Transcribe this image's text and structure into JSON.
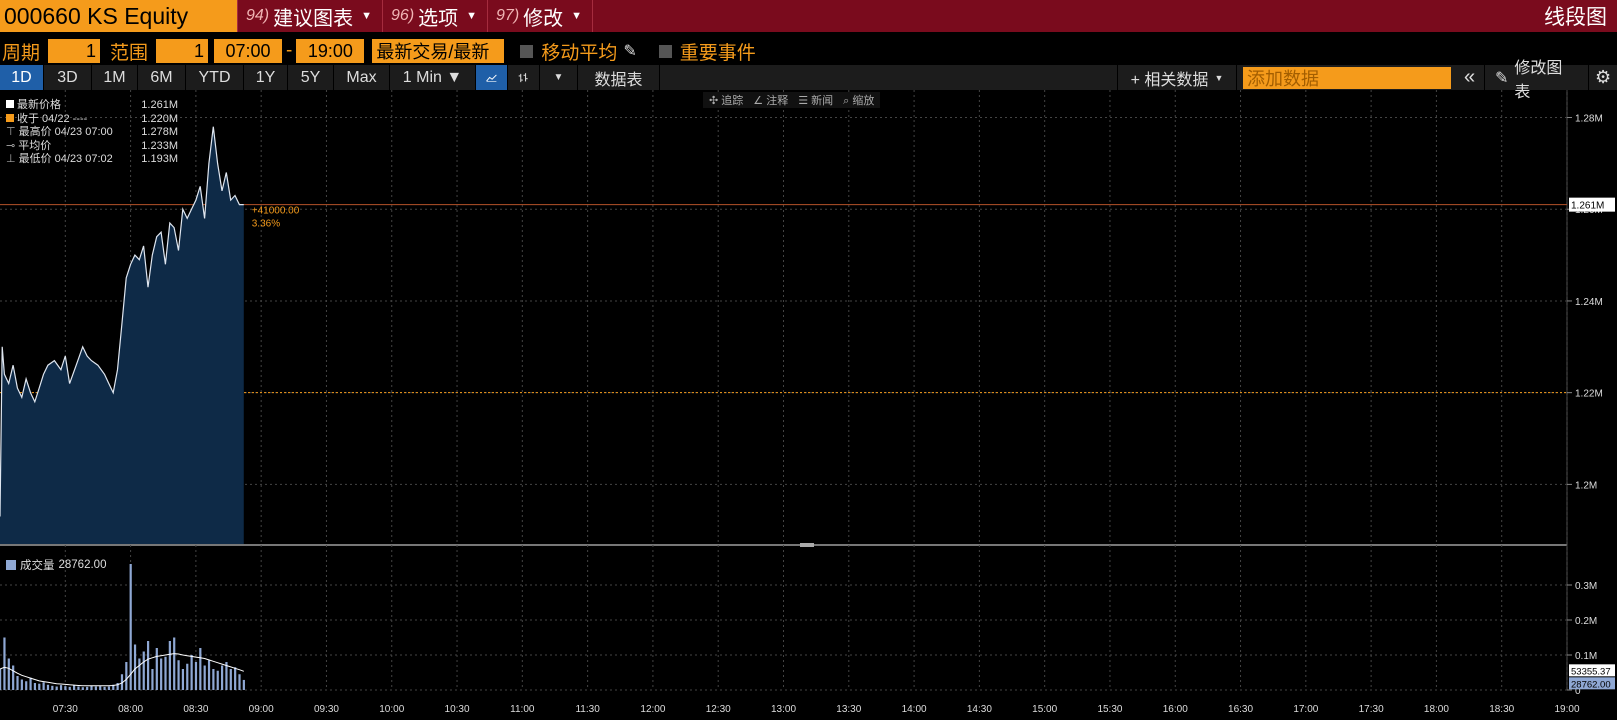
{
  "header": {
    "ticker": "000660 KS Equity",
    "menus": [
      {
        "num": "94)",
        "label": "建议图表"
      },
      {
        "num": "96)",
        "label": "选项"
      },
      {
        "num": "97)",
        "label": "修改"
      }
    ],
    "right_title": "线段图"
  },
  "controls": {
    "period_label": "周期",
    "period_value": "1",
    "range_label": "范围",
    "range_value": "1",
    "time_start": "07:00",
    "time_sep": "-",
    "time_end": "19:00",
    "price_type": "最新交易/最新",
    "moving_avg": "移动平均",
    "events": "重要事件"
  },
  "toolbar": {
    "ranges": [
      "1D",
      "3D",
      "1M",
      "6M",
      "YTD",
      "1Y",
      "5Y",
      "Max"
    ],
    "active_range": "1D",
    "interval": "1 Min ▼",
    "data_table": "数据表",
    "related_data": "+ 相关数据",
    "add_data_placeholder": "添加数据",
    "collapse": "«",
    "edit_chart": "修改图表",
    "gear": "⚙"
  },
  "chart_tools": [
    "✣ 追踪",
    "∠ 注释",
    "☰ 新闻",
    "⌕ 缩放"
  ],
  "legend": [
    {
      "label": "最新价格",
      "value": "1.261M"
    },
    {
      "label": "收于 04/22 ----",
      "value": "1.220M"
    },
    {
      "label": "最高价 04/23 07:00",
      "value": "1.278M"
    },
    {
      "label": "平均价",
      "value": "1.233M"
    },
    {
      "label": "最低价 04/23 07:02",
      "value": "1.193M"
    }
  ],
  "volume_legend": {
    "label": "成交量",
    "value": "28762.00"
  },
  "change_annotation": {
    "abs": "+41000.00",
    "pct": "3.36%"
  },
  "colors": {
    "accent": "#f59b1b",
    "header_bg": "#7a0b1d",
    "line": "#dfe6f0",
    "fill": "#0e2a47",
    "volume": "#8fa8d4"
  },
  "chart_data": {
    "type": "area",
    "ylim": [
      1187000,
      1286000
    ],
    "y_ticks": [
      "1.28M",
      "1.26M",
      "1.24M",
      "1.22M",
      "1.2M"
    ],
    "y_tick_values": [
      1280000,
      1260000,
      1240000,
      1220000,
      1200000
    ],
    "last_price_label": "1.261M",
    "last_price": 1261000,
    "prev_close": 1220000,
    "x_ticks": [
      "07:30",
      "08:00",
      "08:30",
      "09:00",
      "09:30",
      "10:00",
      "10:30",
      "11:00",
      "11:30",
      "12:00",
      "12:30",
      "13:00",
      "13:30",
      "14:00",
      "14:30",
      "15:00",
      "15:30",
      "16:00",
      "16:30",
      "17:00",
      "17:30",
      "18:00",
      "18:30",
      "19:00"
    ],
    "x_range_minutes": [
      420,
      1140
    ],
    "series": [
      {
        "x": [
          420,
          421,
          422,
          424,
          426,
          428,
          430,
          432,
          434,
          436,
          438,
          440,
          442,
          445,
          448,
          450,
          452,
          455,
          458,
          460,
          462,
          465,
          468,
          470,
          472,
          474,
          476,
          478,
          480,
          482,
          484,
          486,
          488,
          490,
          492,
          494,
          496,
          498,
          500,
          502,
          504,
          506,
          508,
          510,
          512,
          514,
          516,
          518,
          520,
          522,
          524,
          526,
          528,
          530,
          532
        ],
        "y": [
          1193000,
          1230000,
          1224000,
          1222000,
          1226000,
          1221000,
          1219000,
          1223000,
          1220000,
          1218000,
          1221000,
          1224000,
          1226000,
          1227000,
          1225000,
          1228000,
          1222000,
          1226000,
          1230000,
          1228000,
          1227000,
          1226000,
          1224000,
          1222000,
          1220000,
          1225000,
          1235000,
          1245000,
          1248000,
          1250000,
          1249000,
          1252000,
          1243000,
          1250000,
          1254000,
          1255000,
          1248000,
          1257000,
          1256000,
          1251000,
          1260000,
          1258000,
          1260000,
          1262000,
          1265000,
          1258000,
          1270000,
          1278000,
          1270000,
          1264000,
          1268000,
          1262000,
          1263000,
          1261000,
          1261000
        ]
      }
    ],
    "volume_ticks": [
      "0.3M",
      "0.2M",
      "0.1M",
      "0"
    ],
    "volume_tick_values": [
      300000,
      200000,
      100000,
      0
    ],
    "volume_last_labels": [
      "53355.37",
      "28762.00"
    ],
    "volume_ylim": [
      0,
      380000
    ],
    "volume_x": [
      420,
      422,
      424,
      426,
      428,
      430,
      432,
      434,
      436,
      438,
      440,
      442,
      444,
      446,
      448,
      450,
      452,
      454,
      456,
      458,
      460,
      462,
      464,
      466,
      468,
      470,
      472,
      474,
      476,
      478,
      480,
      482,
      484,
      486,
      488,
      490,
      492,
      494,
      496,
      498,
      500,
      502,
      504,
      506,
      508,
      510,
      512,
      514,
      516,
      518,
      520,
      522,
      524,
      526,
      528,
      530,
      532
    ],
    "volume": [
      60000,
      150000,
      90000,
      70000,
      40000,
      30000,
      25000,
      35000,
      20000,
      18000,
      22000,
      15000,
      12000,
      10000,
      14000,
      11000,
      9000,
      13000,
      10000,
      8000,
      9000,
      12000,
      10000,
      11000,
      9000,
      10000,
      15000,
      20000,
      45000,
      80000,
      360000,
      130000,
      90000,
      110000,
      140000,
      60000,
      120000,
      90000,
      95000,
      140000,
      150000,
      85000,
      60000,
      75000,
      100000,
      80000,
      120000,
      70000,
      85000,
      60000,
      55000,
      70000,
      80000,
      60000,
      65000,
      45000,
      28762
    ],
    "volume_ma": [
      60000,
      65000,
      62000,
      55000,
      48000,
      42000,
      38000,
      34000,
      30000,
      26000,
      24000,
      22000,
      20000,
      18000,
      17000,
      16000,
      15000,
      14000,
      13000,
      12000,
      12000,
      12000,
      12000,
      12000,
      12000,
      12000,
      13000,
      15000,
      20000,
      30000,
      45000,
      60000,
      70000,
      80000,
      88000,
      92000,
      96000,
      98000,
      100000,
      102000,
      104000,
      103000,
      100000,
      98000,
      96000,
      94000,
      92000,
      90000,
      86000,
      82000,
      78000,
      74000,
      70000,
      66000,
      62000,
      58000,
      53355
    ]
  }
}
